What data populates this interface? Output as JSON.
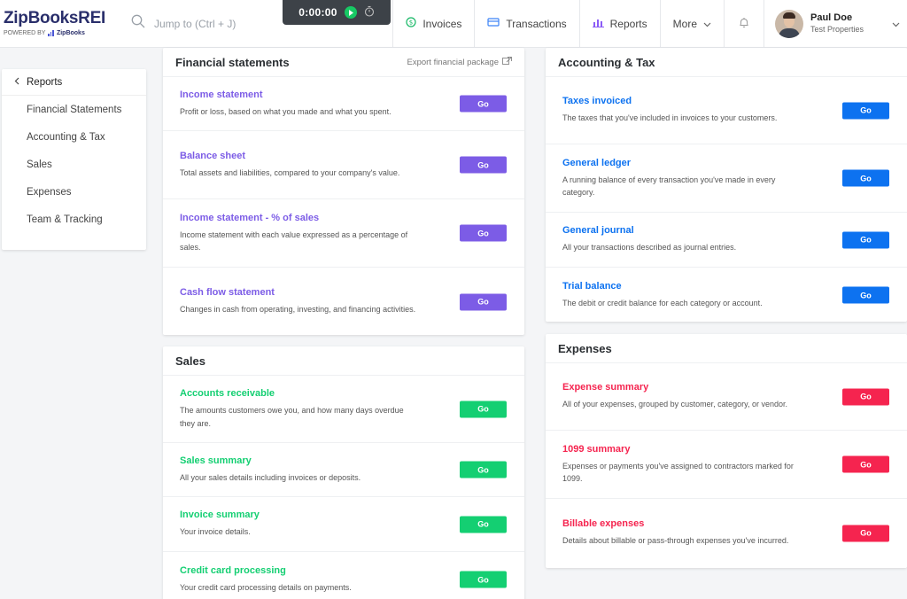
{
  "brand": {
    "name": "ZipBooksREI",
    "powered_by": "POWERED BY",
    "powered_name": "ZipBooks"
  },
  "search": {
    "placeholder": "Jump to (Ctrl + J)"
  },
  "timer": {
    "time_main": "0:00:",
    "time_sec": "00"
  },
  "nav": {
    "invoices": "Invoices",
    "transactions": "Transactions",
    "reports": "Reports",
    "more": "More"
  },
  "user": {
    "name": "Paul Doe",
    "org": "Test Properties"
  },
  "sidebar": {
    "back_label": "Reports",
    "items": [
      {
        "label": "Financial Statements"
      },
      {
        "label": "Accounting & Tax"
      },
      {
        "label": "Sales"
      },
      {
        "label": "Expenses"
      },
      {
        "label": "Team & Tracking"
      }
    ]
  },
  "colors": {
    "purple": "#7c5ce6",
    "green": "#14cf72",
    "blue": "#0d72f0",
    "red": "#f5244f"
  },
  "go_label": "Go",
  "financial": {
    "title": "Financial statements",
    "export_label": "Export financial package",
    "rows": [
      {
        "title": "Income statement",
        "desc": "Profit or loss, based on what you made and what you spent."
      },
      {
        "title": "Balance sheet",
        "desc": "Total assets and liabilities, compared to your company's value."
      },
      {
        "title": "Income statement - % of sales",
        "desc": "Income statement with each value expressed as a percentage of sales."
      },
      {
        "title": "Cash flow statement",
        "desc": "Changes in cash from operating, investing, and financing activities."
      }
    ]
  },
  "sales": {
    "title": "Sales",
    "rows": [
      {
        "title": "Accounts receivable",
        "desc": "The amounts customers owe you, and how many days overdue they are."
      },
      {
        "title": "Sales summary",
        "desc": "All your sales details including invoices or deposits."
      },
      {
        "title": "Invoice summary",
        "desc": "Your invoice details."
      },
      {
        "title": "Credit card processing",
        "desc": "Your credit card processing details on payments."
      }
    ]
  },
  "accounting": {
    "title": "Accounting & Tax",
    "rows": [
      {
        "title": "Taxes invoiced",
        "desc": "The taxes that you've included in invoices to your customers."
      },
      {
        "title": "General ledger",
        "desc": "A running balance of every transaction you've made in every category."
      },
      {
        "title": "General journal",
        "desc": "All your transactions described as journal entries."
      },
      {
        "title": "Trial balance",
        "desc": "The debit or credit balance for each category or account."
      }
    ]
  },
  "expenses": {
    "title": "Expenses",
    "rows": [
      {
        "title": "Expense summary",
        "desc": "All of your expenses, grouped by customer, category, or vendor."
      },
      {
        "title": "1099 summary",
        "desc": "Expenses or payments you've assigned to contractors marked for 1099."
      },
      {
        "title": "Billable expenses",
        "desc": "Details about billable or pass-through expenses you've incurred."
      }
    ]
  }
}
